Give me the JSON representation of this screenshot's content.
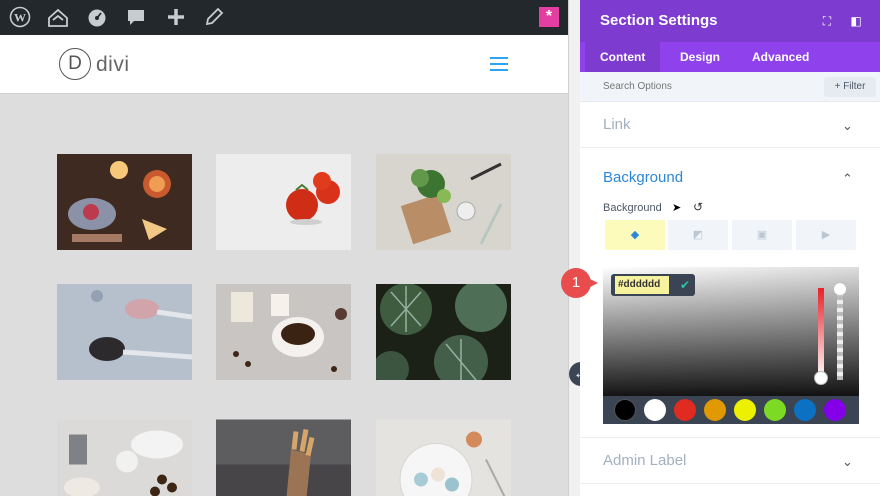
{
  "preview": {
    "logo_letter": "D",
    "logo_text": "divi"
  },
  "toolbar": {
    "icons": [
      "wordpress-icon",
      "dashboard-icon",
      "gauge-icon",
      "comment-icon",
      "plus-icon",
      "pencil-icon"
    ]
  },
  "builder": {
    "launch_icon": "asterisk-icon"
  },
  "panel": {
    "title": "Section Settings",
    "tabs": [
      "Content",
      "Design",
      "Advanced"
    ],
    "active_tab": "Content",
    "search_placeholder": "Search Options",
    "filter_label": "+ Filter",
    "sections": {
      "link": "Link",
      "background": "Background",
      "admin_label": "Admin Label"
    },
    "background_label": "Background",
    "background_types": [
      "color-icon",
      "gradient-icon",
      "image-icon",
      "video-icon"
    ],
    "hex_value": "#dddddd",
    "callout_number": "1",
    "swatches": [
      "#000000",
      "#ffffff",
      "#e02b20",
      "#e09900",
      "#edf000",
      "#7cda24",
      "#0c71c3",
      "#8300e9"
    ]
  },
  "colors": {
    "panel_header": "#7e3bd0",
    "tab_bar": "#8f42ec",
    "accent_blue": "#2b87da",
    "page_bg": "#dddddd"
  }
}
